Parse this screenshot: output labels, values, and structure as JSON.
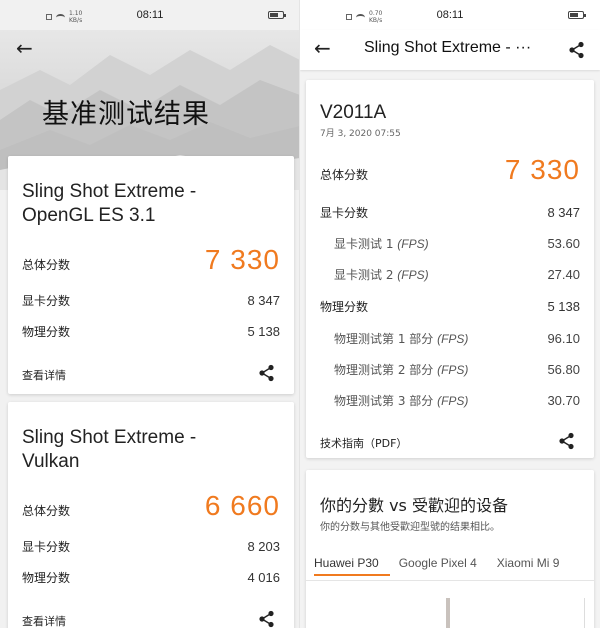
{
  "status_left": {
    "time": "08:11",
    "speed": "1.10\nKB/s"
  },
  "status_right": {
    "time": "08:11",
    "speed": "0.70\nKB/s"
  },
  "left": {
    "hero_title": "基准测试结果",
    "card1": {
      "title_line1": "Sling Shot Extreme -",
      "title_line2": "OpenGL ES 3.1",
      "overall_label": "总体分数",
      "overall_value": "7 330",
      "graphics_label": "显卡分数",
      "graphics_value": "8 347",
      "physics_label": "物理分数",
      "physics_value": "5 138",
      "details_link": "查看详情"
    },
    "card2": {
      "title_line1": "Sling Shot Extreme -",
      "title_line2": "Vulkan",
      "overall_label": "总体分数",
      "overall_value": "6 660",
      "graphics_label": "显卡分数",
      "graphics_value": "8 203",
      "physics_label": "物理分数",
      "physics_value": "4 016",
      "details_link": "查看详情"
    }
  },
  "right": {
    "header_title": "Sling Shot Extreme - ···",
    "device": "V2011A",
    "date": "7月 3, 2020 07:55",
    "overall_label": "总体分数",
    "overall_value": "7 330",
    "graphics_label": "显卡分数",
    "graphics_value": "8 347",
    "graphics_tests": [
      {
        "label": "显卡测试 1 ",
        "unit": "(FPS)",
        "value": "53.60"
      },
      {
        "label": "显卡测试 2 ",
        "unit": "(FPS)",
        "value": "27.40"
      }
    ],
    "physics_label": "物理分数",
    "physics_value": "5 138",
    "physics_tests": [
      {
        "label": "物理测试第 1 部分 ",
        "unit": "(FPS)",
        "value": "96.10"
      },
      {
        "label": "物理测试第 2 部分 ",
        "unit": "(FPS)",
        "value": "56.80"
      },
      {
        "label": "物理测试第 3 部分 ",
        "unit": "(FPS)",
        "value": "30.70"
      }
    ],
    "guide_link": "技术指南（PDF）",
    "compare_title": "你的分數 vs 受歡迎的设备",
    "compare_subtitle": "你的分数与其他受歡迎型號的结果相比。",
    "tabs": [
      "Huawei P30",
      "Google Pixel 4",
      "Xiaomi Mi 9"
    ]
  },
  "colors": {
    "accent": "#f07a1f"
  }
}
